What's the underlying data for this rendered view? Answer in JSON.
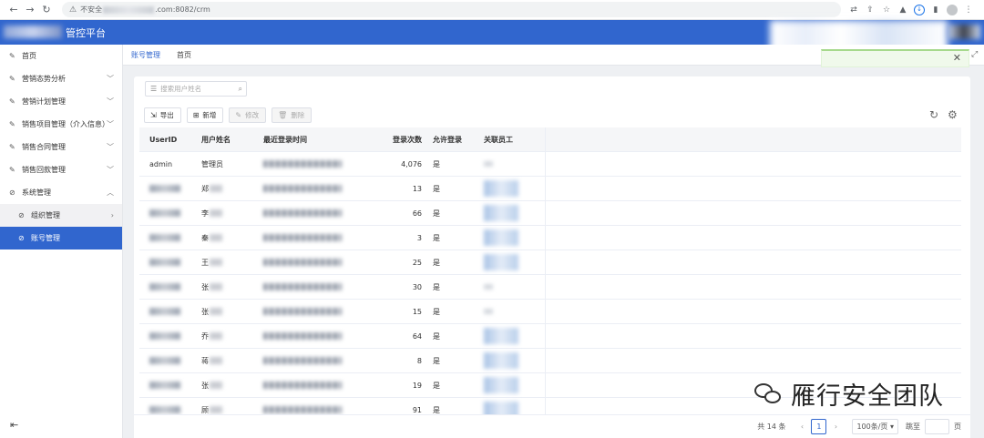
{
  "browser": {
    "url_prefix": "不安全",
    "url_suffix": ".com:8082/crm"
  },
  "app": {
    "title": "管控平台"
  },
  "sidebar": {
    "items": [
      {
        "label": "首页",
        "icon": "pencil-icon",
        "chevron": ""
      },
      {
        "label": "营销态势分析",
        "icon": "pencil-icon",
        "chevron": "down"
      },
      {
        "label": "营销计划管理",
        "icon": "pencil-icon",
        "chevron": "down"
      },
      {
        "label": "销售项目管理（介入信息）",
        "icon": "pencil-icon",
        "chevron": "down"
      },
      {
        "label": "销售合同管理",
        "icon": "pencil-icon",
        "chevron": "down"
      },
      {
        "label": "销售回款管理",
        "icon": "pencil-icon",
        "chevron": "down"
      },
      {
        "label": "系统管理",
        "icon": "check-circle-icon",
        "chevron": "up"
      },
      {
        "label": "组织管理",
        "icon": "check-circle-icon",
        "chevron": "right"
      },
      {
        "label": "账号管理",
        "icon": "check-circle-icon",
        "chevron": ""
      }
    ]
  },
  "tabs": [
    {
      "label": "账号管理",
      "active": true
    },
    {
      "label": "首页",
      "active": false
    }
  ],
  "search": {
    "placeholder": "搜索用户姓名"
  },
  "toolbar": {
    "export": "导出",
    "add": "新增",
    "edit": "修改",
    "delete": "删除"
  },
  "table": {
    "headers": [
      "UserID",
      "用户姓名",
      "最近登录时间",
      "登录次数",
      "允许登录",
      "关联员工"
    ],
    "rows": [
      {
        "user_id": "admin",
        "name": "管理员",
        "count": "4,076",
        "allow": "是"
      },
      {
        "user_id": "",
        "name": "郑",
        "count": "13",
        "allow": "是"
      },
      {
        "user_id": "",
        "name": "李",
        "count": "66",
        "allow": "是"
      },
      {
        "user_id": "",
        "name": "秦",
        "count": "3",
        "allow": "是"
      },
      {
        "user_id": "",
        "name": "王",
        "count": "25",
        "allow": "是"
      },
      {
        "user_id": "",
        "name": "张",
        "count": "30",
        "allow": "是"
      },
      {
        "user_id": "",
        "name": "张",
        "count": "15",
        "allow": "是"
      },
      {
        "user_id": "",
        "name": "乔",
        "count": "64",
        "allow": "是"
      },
      {
        "user_id": "",
        "name": "蒋",
        "count": "8",
        "allow": "是"
      },
      {
        "user_id": "",
        "name": "张",
        "count": "19",
        "allow": "是"
      },
      {
        "user_id": "",
        "name": "顾",
        "count": "91",
        "allow": "是"
      }
    ]
  },
  "pagination": {
    "total": "共 14 条",
    "current_page": "1",
    "page_size": "100条/页",
    "jump_label": "跳至",
    "page_unit": "页"
  },
  "watermark": {
    "text": "雁行安全团队"
  },
  "colors": {
    "primary": "#3166ce",
    "toast_bg": "#f0f9eb"
  }
}
